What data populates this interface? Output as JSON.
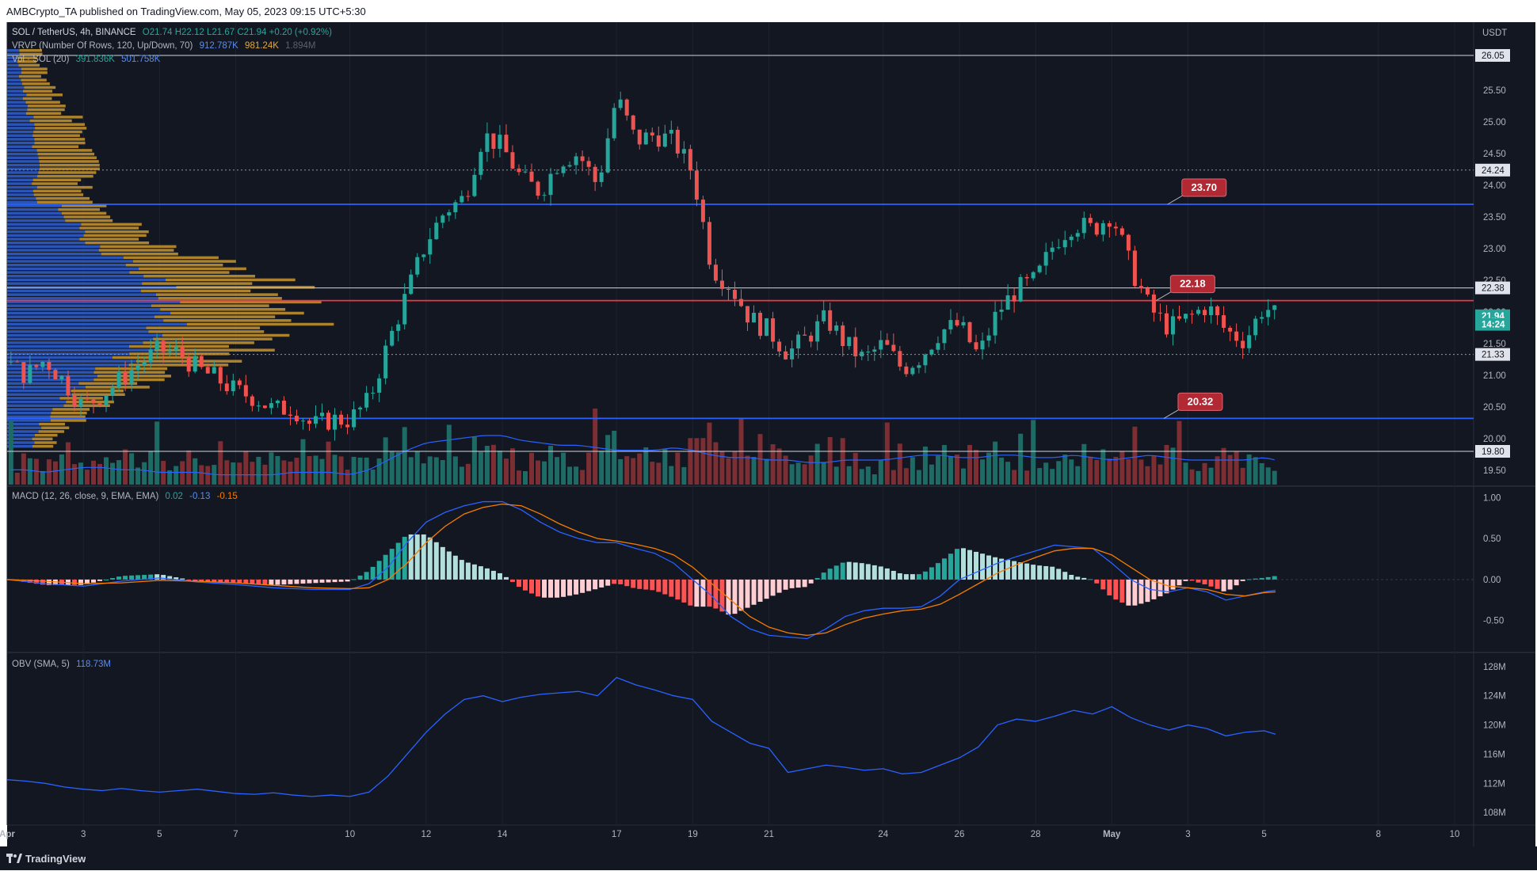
{
  "header": {
    "publisher": "AMBCrypto_TA published on TradingView.com, May 05, 2023 09:15 UTC+5:30"
  },
  "footer": {
    "brand": "TradingView"
  },
  "colors": {
    "up": "#26a69a",
    "down": "#ef5350",
    "vol_up": "#1e6b66",
    "vol_down": "#7c2e33",
    "vrvp_up": "#2f5fd0",
    "vrvp_down": "#c9952f",
    "macd": "#2962ff",
    "signal": "#f57c00",
    "obv": "#2962ff",
    "support": "#2962ff",
    "red_line": "#f23645",
    "label_red": "#b22833"
  },
  "legend": {
    "symbol": "SOL / TetherUS, 4h, BINANCE",
    "ohlc": "O21.74 H22.12 L21.67 C21.94 +0.20 (+0.92%)",
    "vrvp_name": "VRVP (Number Of Rows, 120, Up/Down, 70)",
    "vrvp_v1": "912.787K",
    "vrvp_v2": "981.24K",
    "vrvp_v3": "1.894M",
    "vol_name": "Vol · SOL (20)",
    "vol_v1": "391.836K",
    "vol_v2": "501.758K",
    "macd_name": "MACD (12, 26, close, 9, EMA, EMA)",
    "macd_v1": "0.02",
    "macd_v2": "-0.13",
    "macd_v3": "-0.15",
    "obv_name": "OBV (SMA, 5)",
    "obv_v1": "118.73M"
  },
  "chart_data": {
    "type": "candlestick",
    "symbol": "SOL / TetherUS",
    "interval": "4h",
    "exchange": "BINANCE",
    "currency": "USDT",
    "price_axis": {
      "ylim": [
        19.3,
        26.3
      ],
      "ticks": [
        "19.50",
        "20.00",
        "20.50",
        "21.00",
        "21.50",
        "22.00",
        "22.50",
        "23.00",
        "23.50",
        "24.00",
        "24.50",
        "25.00",
        "25.50",
        "26.00"
      ],
      "tick_values": [
        19.5,
        20.0,
        20.5,
        21.0,
        21.5,
        22.0,
        22.5,
        23.0,
        23.5,
        24.0,
        24.5,
        25.0,
        25.5,
        26.0
      ]
    },
    "price_labels": [
      {
        "value": 26.05,
        "text": "26.05",
        "style": "white"
      },
      {
        "value": 24.24,
        "text": "24.24",
        "style": "white"
      },
      {
        "value": 22.38,
        "text": "22.38",
        "style": "white"
      },
      {
        "value": 21.33,
        "text": "21.33",
        "style": "white"
      },
      {
        "value": 19.8,
        "text": "19.80",
        "style": "white"
      },
      {
        "value": 21.94,
        "text": "21.94",
        "style": "current"
      },
      {
        "value": 21.805,
        "text": "14:24",
        "style": "current"
      }
    ],
    "horizontal_lines": [
      {
        "value": 26.05,
        "style": "solid-white"
      },
      {
        "value": 24.24,
        "style": "dotted-white"
      },
      {
        "value": 23.7,
        "style": "solid-blue"
      },
      {
        "value": 22.38,
        "style": "solid-white"
      },
      {
        "value": 22.18,
        "style": "solid-red"
      },
      {
        "value": 21.33,
        "style": "dotted-white"
      },
      {
        "value": 20.32,
        "style": "solid-blue"
      },
      {
        "value": 19.8,
        "style": "solid-white"
      }
    ],
    "callouts": [
      {
        "text": "23.70",
        "value": 23.7,
        "day": 31.3
      },
      {
        "text": "22.18",
        "value": 22.18,
        "day": 31.0
      },
      {
        "text": "20.32",
        "value": 20.32,
        "day": 31.2
      }
    ],
    "time_axis": {
      "ticks": [
        "Apr",
        "3",
        "5",
        "7",
        "10",
        "12",
        "14",
        "17",
        "19",
        "21",
        "24",
        "26",
        "28",
        "May",
        "3",
        "5",
        "8",
        "10"
      ],
      "tick_days": [
        1,
        3,
        5,
        7,
        10,
        12,
        14,
        17,
        19,
        21,
        24,
        26,
        28,
        30,
        32,
        34,
        37,
        39
      ],
      "xlim": [
        1,
        39.5
      ]
    },
    "price_path": {
      "days": [
        1,
        1.5,
        2,
        2.5,
        3,
        3.5,
        4,
        4.5,
        5,
        5.5,
        6,
        6.5,
        7,
        7.5,
        8,
        8.5,
        9,
        9.5,
        10,
        10.5,
        11,
        11.5,
        12,
        12.5,
        13,
        13.5,
        14,
        14.5,
        15,
        15.5,
        16,
        16.5,
        17,
        17.5,
        18,
        18.5,
        19,
        19.5,
        20,
        20.5,
        21,
        21.5,
        22,
        22.5,
        23,
        23.5,
        24,
        24.5,
        25,
        25.5,
        26,
        26.5,
        27,
        27.5,
        28,
        28.5,
        29,
        29.5,
        30,
        30.5,
        31,
        31.5,
        32,
        32.5,
        33,
        33.5,
        34,
        34.3
      ],
      "closes": [
        21.2,
        21.0,
        21.25,
        20.9,
        20.5,
        20.7,
        20.95,
        21.2,
        21.4,
        21.35,
        21.1,
        20.95,
        20.75,
        20.65,
        20.45,
        20.5,
        20.2,
        20.3,
        20.3,
        20.6,
        21.5,
        22.3,
        23.1,
        23.6,
        23.8,
        24.8,
        24.6,
        24.1,
        23.9,
        24.4,
        24.5,
        24.0,
        25.4,
        24.7,
        24.8,
        24.7,
        24.2,
        22.7,
        22.4,
        21.9,
        21.7,
        21.35,
        21.6,
        21.9,
        21.5,
        21.25,
        21.5,
        21.1,
        21.3,
        21.7,
        21.8,
        21.3,
        22.0,
        22.35,
        22.5,
        23.1,
        23.4,
        23.3,
        23.55,
        22.7,
        22.05,
        21.75,
        21.9,
        22.1,
        21.7,
        21.55,
        22.1,
        21.94
      ]
    },
    "volume_panel": {
      "sma_line": [
        0.3,
        0.3,
        0.25,
        0.3,
        0.35,
        0.35,
        0.3,
        0.3,
        0.25,
        0.25,
        0.25,
        0.2,
        0.2,
        0.2,
        0.2,
        0.25,
        0.25,
        0.25,
        0.2,
        0.3,
        0.5,
        0.7,
        0.85,
        0.9,
        0.95,
        1.0,
        1.0,
        0.9,
        0.85,
        0.8,
        0.8,
        0.75,
        0.7,
        0.7,
        0.7,
        0.75,
        0.7,
        0.6,
        0.55,
        0.55,
        0.5,
        0.5,
        0.45,
        0.45,
        0.5,
        0.5,
        0.5,
        0.55,
        0.6,
        0.6,
        0.55,
        0.55,
        0.6,
        0.6,
        0.55,
        0.55,
        0.6,
        0.55,
        0.5,
        0.55,
        0.6,
        0.55,
        0.5,
        0.5,
        0.5,
        0.5,
        0.55,
        0.5
      ]
    },
    "macd_panel": {
      "ticks": [
        "1.00",
        "0.50",
        "0.00",
        "-0.50"
      ],
      "tick_values": [
        1.0,
        0.5,
        0.0,
        -0.5
      ],
      "ylim": [
        -0.85,
        1.1
      ],
      "days": [
        1,
        2,
        3,
        4,
        5,
        6,
        7,
        8,
        9,
        10,
        10.5,
        11,
        11.5,
        12,
        12.5,
        13,
        13.5,
        14,
        14.5,
        15,
        15.5,
        16,
        16.5,
        17,
        17.5,
        18,
        18.5,
        19,
        19.5,
        20,
        20.5,
        21,
        21.5,
        22,
        22.5,
        23,
        23.5,
        24,
        24.5,
        25,
        25.5,
        26,
        26.5,
        27,
        27.5,
        28,
        28.5,
        29,
        29.5,
        30,
        30.5,
        31,
        31.5,
        32,
        32.5,
        33,
        33.5,
        34,
        34.3
      ],
      "macd": [
        0.0,
        -0.05,
        -0.08,
        -0.02,
        0.02,
        -0.03,
        -0.06,
        -0.1,
        -0.12,
        -0.12,
        -0.05,
        0.15,
        0.45,
        0.7,
        0.82,
        0.9,
        0.95,
        0.95,
        0.85,
        0.7,
        0.58,
        0.5,
        0.45,
        0.45,
        0.38,
        0.32,
        0.2,
        0.0,
        -0.2,
        -0.45,
        -0.6,
        -0.68,
        -0.7,
        -0.72,
        -0.6,
        -0.45,
        -0.38,
        -0.35,
        -0.35,
        -0.33,
        -0.2,
        0.0,
        0.1,
        0.2,
        0.28,
        0.35,
        0.42,
        0.4,
        0.38,
        0.2,
        0.0,
        -0.12,
        -0.15,
        -0.1,
        -0.15,
        -0.25,
        -0.2,
        -0.15,
        -0.13
      ],
      "signal": [
        0.0,
        -0.02,
        -0.05,
        -0.04,
        -0.01,
        -0.02,
        -0.04,
        -0.07,
        -0.1,
        -0.11,
        -0.1,
        0.0,
        0.2,
        0.45,
        0.65,
        0.8,
        0.88,
        0.92,
        0.9,
        0.8,
        0.68,
        0.58,
        0.5,
        0.47,
        0.43,
        0.38,
        0.3,
        0.15,
        -0.05,
        -0.25,
        -0.45,
        -0.58,
        -0.65,
        -0.68,
        -0.65,
        -0.55,
        -0.47,
        -0.42,
        -0.38,
        -0.36,
        -0.3,
        -0.18,
        -0.05,
        0.08,
        0.18,
        0.27,
        0.35,
        0.38,
        0.38,
        0.3,
        0.15,
        0.0,
        -0.08,
        -0.1,
        -0.12,
        -0.18,
        -0.2,
        -0.16,
        -0.15
      ]
    },
    "obv_panel": {
      "ticks": [
        "128M",
        "124M",
        "120M",
        "116M",
        "112M",
        "108M"
      ],
      "tick_values": [
        128,
        124,
        120,
        116,
        112,
        108
      ],
      "ylim": [
        106.5,
        129.5
      ],
      "days": [
        1,
        1.5,
        2,
        2.5,
        3,
        3.5,
        4,
        4.5,
        5,
        5.5,
        6,
        6.5,
        7,
        7.5,
        8,
        8.5,
        9,
        9.5,
        10,
        10.5,
        11,
        11.5,
        12,
        12.5,
        13,
        13.5,
        14,
        14.5,
        15,
        15.5,
        16,
        16.5,
        17,
        17.5,
        18,
        18.5,
        19,
        19.5,
        20,
        20.5,
        21,
        21.5,
        22,
        22.5,
        23,
        23.5,
        24,
        24.5,
        25,
        25.5,
        26,
        26.5,
        27,
        27.5,
        28,
        28.5,
        29,
        29.5,
        30,
        30.5,
        31,
        31.5,
        32,
        32.5,
        33,
        33.5,
        34,
        34.3
      ],
      "values": [
        112.5,
        112.3,
        112.0,
        111.5,
        111.2,
        111.0,
        111.3,
        111.0,
        110.8,
        111.0,
        111.2,
        110.9,
        110.6,
        110.5,
        110.7,
        110.4,
        110.2,
        110.4,
        110.2,
        110.8,
        113.0,
        116.0,
        119.0,
        121.5,
        123.5,
        124.0,
        123.2,
        123.8,
        124.2,
        124.4,
        124.6,
        124.0,
        126.5,
        125.5,
        124.8,
        124.0,
        123.5,
        120.5,
        119.0,
        117.5,
        116.8,
        113.5,
        114.0,
        114.5,
        114.2,
        113.8,
        114.0,
        113.3,
        113.5,
        114.5,
        115.5,
        117.0,
        120.0,
        120.8,
        120.5,
        121.2,
        122.0,
        121.5,
        122.5,
        121.0,
        120.0,
        119.3,
        120.0,
        119.5,
        118.5,
        119.0,
        119.2,
        118.73
      ]
    },
    "volume_profile": {
      "price_step": 0.0584,
      "price_min": 19.85,
      "note": "bars are reconstructed in script"
    }
  }
}
